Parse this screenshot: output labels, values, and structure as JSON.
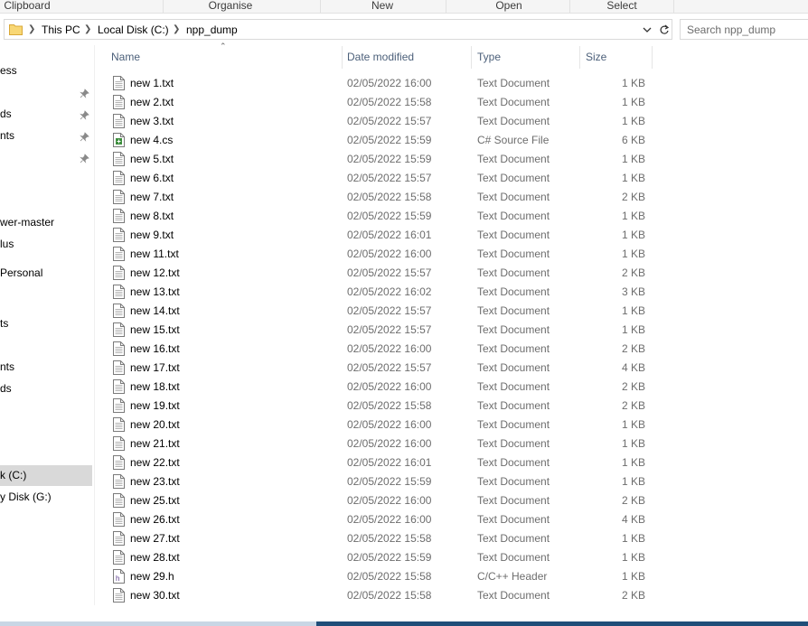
{
  "ribbon": {
    "groups": [
      "Clipboard",
      "Organise",
      "New",
      "Open",
      "Select"
    ]
  },
  "address": {
    "crumbs": [
      "This PC",
      "Local Disk (C:)",
      "npp_dump"
    ]
  },
  "search": {
    "placeholder": "Search npp_dump"
  },
  "nav": {
    "items": [
      {
        "label": "ess",
        "pinned": false
      },
      {
        "label": "",
        "pinned": true
      },
      {
        "label": "ds",
        "pinned": true
      },
      {
        "label": "nts",
        "pinned": true
      },
      {
        "label": "",
        "pinned": true
      },
      {
        "label": "wer-master",
        "pinned": false
      },
      {
        "label": "lus",
        "pinned": false
      },
      {
        "label": " Personal",
        "pinned": false
      },
      {
        "label": "ts",
        "pinned": false
      },
      {
        "label": "nts",
        "pinned": false
      },
      {
        "label": "ds",
        "pinned": false
      },
      {
        "label": "k (C:)",
        "pinned": false,
        "selected": true
      },
      {
        "label": "y Disk (G:)",
        "pinned": false
      }
    ]
  },
  "columns": {
    "name": "Name",
    "date": "Date modified",
    "type": "Type",
    "size": "Size"
  },
  "files": [
    {
      "name": "new 1.txt",
      "date": "02/05/2022 16:00",
      "type": "Text Document",
      "size": "1 KB",
      "icon": "text-file-icon"
    },
    {
      "name": "new 2.txt",
      "date": "02/05/2022 15:58",
      "type": "Text Document",
      "size": "1 KB",
      "icon": "text-file-icon"
    },
    {
      "name": "new 3.txt",
      "date": "02/05/2022 15:57",
      "type": "Text Document",
      "size": "1 KB",
      "icon": "text-file-icon"
    },
    {
      "name": "new 4.cs",
      "date": "02/05/2022 15:59",
      "type": "C# Source File",
      "size": "6 KB",
      "icon": "csharp-file-icon"
    },
    {
      "name": "new 5.txt",
      "date": "02/05/2022 15:59",
      "type": "Text Document",
      "size": "1 KB",
      "icon": "text-file-icon"
    },
    {
      "name": "new 6.txt",
      "date": "02/05/2022 15:57",
      "type": "Text Document",
      "size": "1 KB",
      "icon": "text-file-icon"
    },
    {
      "name": "new 7.txt",
      "date": "02/05/2022 15:58",
      "type": "Text Document",
      "size": "2 KB",
      "icon": "text-file-icon"
    },
    {
      "name": "new 8.txt",
      "date": "02/05/2022 15:59",
      "type": "Text Document",
      "size": "1 KB",
      "icon": "text-file-icon"
    },
    {
      "name": "new 9.txt",
      "date": "02/05/2022 16:01",
      "type": "Text Document",
      "size": "1 KB",
      "icon": "text-file-icon"
    },
    {
      "name": "new 11.txt",
      "date": "02/05/2022 16:00",
      "type": "Text Document",
      "size": "1 KB",
      "icon": "text-file-icon"
    },
    {
      "name": "new 12.txt",
      "date": "02/05/2022 15:57",
      "type": "Text Document",
      "size": "2 KB",
      "icon": "text-file-icon"
    },
    {
      "name": "new 13.txt",
      "date": "02/05/2022 16:02",
      "type": "Text Document",
      "size": "3 KB",
      "icon": "text-file-icon"
    },
    {
      "name": "new 14.txt",
      "date": "02/05/2022 15:57",
      "type": "Text Document",
      "size": "1 KB",
      "icon": "text-file-icon"
    },
    {
      "name": "new 15.txt",
      "date": "02/05/2022 15:57",
      "type": "Text Document",
      "size": "1 KB",
      "icon": "text-file-icon"
    },
    {
      "name": "new 16.txt",
      "date": "02/05/2022 16:00",
      "type": "Text Document",
      "size": "2 KB",
      "icon": "text-file-icon"
    },
    {
      "name": "new 17.txt",
      "date": "02/05/2022 15:57",
      "type": "Text Document",
      "size": "4 KB",
      "icon": "text-file-icon"
    },
    {
      "name": "new 18.txt",
      "date": "02/05/2022 16:00",
      "type": "Text Document",
      "size": "2 KB",
      "icon": "text-file-icon"
    },
    {
      "name": "new 19.txt",
      "date": "02/05/2022 15:58",
      "type": "Text Document",
      "size": "2 KB",
      "icon": "text-file-icon"
    },
    {
      "name": "new 20.txt",
      "date": "02/05/2022 16:00",
      "type": "Text Document",
      "size": "1 KB",
      "icon": "text-file-icon"
    },
    {
      "name": "new 21.txt",
      "date": "02/05/2022 16:00",
      "type": "Text Document",
      "size": "1 KB",
      "icon": "text-file-icon"
    },
    {
      "name": "new 22.txt",
      "date": "02/05/2022 16:01",
      "type": "Text Document",
      "size": "1 KB",
      "icon": "text-file-icon"
    },
    {
      "name": "new 23.txt",
      "date": "02/05/2022 15:59",
      "type": "Text Document",
      "size": "1 KB",
      "icon": "text-file-icon"
    },
    {
      "name": "new 25.txt",
      "date": "02/05/2022 16:00",
      "type": "Text Document",
      "size": "2 KB",
      "icon": "text-file-icon"
    },
    {
      "name": "new 26.txt",
      "date": "02/05/2022 16:00",
      "type": "Text Document",
      "size": "4 KB",
      "icon": "text-file-icon"
    },
    {
      "name": "new 27.txt",
      "date": "02/05/2022 15:58",
      "type": "Text Document",
      "size": "1 KB",
      "icon": "text-file-icon"
    },
    {
      "name": "new 28.txt",
      "date": "02/05/2022 15:59",
      "type": "Text Document",
      "size": "1 KB",
      "icon": "text-file-icon"
    },
    {
      "name": "new 29.h",
      "date": "02/05/2022 15:58",
      "type": "C/C++ Header",
      "size": "1 KB",
      "icon": "header-file-icon"
    },
    {
      "name": "new 30.txt",
      "date": "02/05/2022 15:58",
      "type": "Text Document",
      "size": "2 KB",
      "icon": "text-file-icon"
    }
  ],
  "colors": {
    "header_text": "#4c607a",
    "detail_text": "#6d6d6d",
    "selected_bg": "#d9d9d9",
    "csharp_icon": "#3f8f3f"
  }
}
